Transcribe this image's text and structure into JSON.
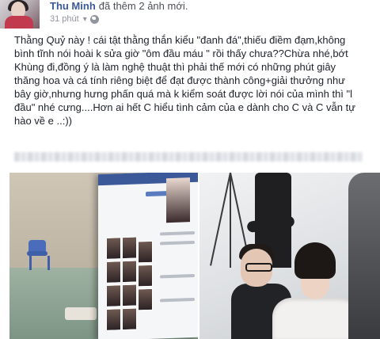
{
  "header": {
    "author": "Thu Minh",
    "action": "đã thêm 2 ảnh mới.",
    "timestamp": "31 phút",
    "privacy_icon": "globe-icon",
    "menu_icon": "chevron-down-icon"
  },
  "post": {
    "lines": [
      "Thằng Quỷ này ! cái tật thằng thắn kiểu \"đanh đá\",thiếu điềm đạm,không",
      "bình tĩnh nói hoài k sửa giờ \"ôm đầu máu \" rồi thấy chưa??Chừa nhé,bớt",
      "Khùng đi,đồng ý là làm nghệ thuật thì phải thế mới có những phút giây",
      "thăng hoa và cá tính riêng biệt để đạt được thành công+giải thưởng như",
      "bây giờ,nhưng hưng phấn quá mà k kiểm soát được lời nói của mình thì \"l",
      "đầu\" nhé cưng....Hơn ai hết C hiểu tình cảm của e dành cho C và C vẫn tự",
      "hào về e ..:))"
    ]
  },
  "colors": {
    "author_link": "#3b5998",
    "text": "#1d2129",
    "meta": "#90949c"
  }
}
